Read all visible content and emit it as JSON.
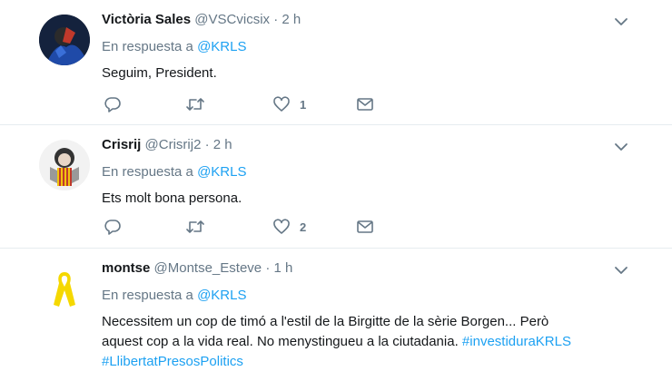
{
  "tweets": [
    {
      "name": "Victòria Sales",
      "handle": "@VSCvicsix",
      "separator": "·",
      "time": "2 h",
      "reply_prefix": "En respuesta a",
      "reply_mention": "@KRLS",
      "text": "Seguim, President.",
      "likes": "1",
      "icons": [
        "chevron-down-icon",
        "reply-icon",
        "retweet-icon",
        "heart-icon",
        "direct-message-icon"
      ]
    },
    {
      "name": "Crisrij",
      "handle": "@Crisrij2",
      "separator": "·",
      "time": "2 h",
      "reply_prefix": "En respuesta a",
      "reply_mention": "@KRLS",
      "text": "Ets molt bona persona.",
      "likes": "2",
      "icons": [
        "chevron-down-icon",
        "reply-icon",
        "retweet-icon",
        "heart-icon",
        "direct-message-icon"
      ]
    },
    {
      "name": "montse",
      "handle": "@Montse_Esteve",
      "separator": "·",
      "time": "1 h",
      "reply_prefix": "En respuesta a",
      "reply_mention": "@KRLS",
      "text_line1": "Necessitem un cop de timó a l'estil de la Birgitte de la sèrie Borgen...  Però",
      "text_line2": "aquest cop a la vida real. No menystingueu a la ciutadania.",
      "hashtag1": "#investiduraKRLS",
      "hashtag2": "#LlibertatPresosPolitics",
      "icons": [
        "chevron-down-icon"
      ]
    }
  ],
  "colors": {
    "link": "#1da1f2",
    "secondary": "#657786",
    "primary": "#14171a",
    "divider": "#e6ecf0",
    "ribbon": "#f5d800"
  }
}
